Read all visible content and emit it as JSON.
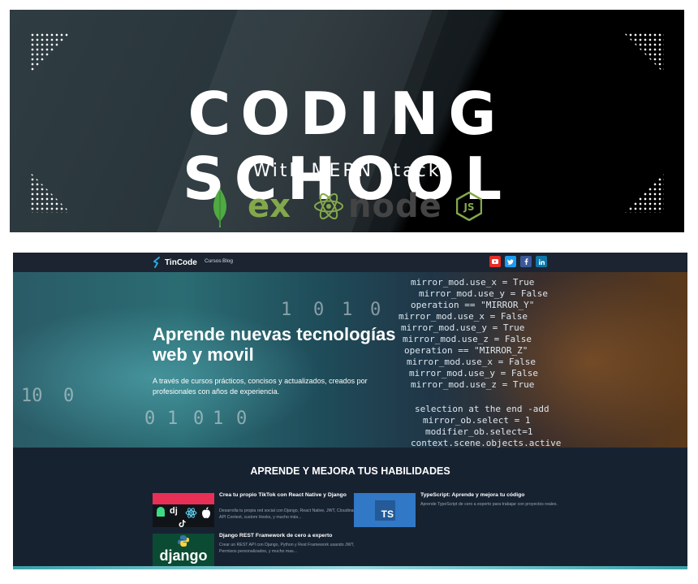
{
  "banner": {
    "title": "CODING SCHOOL",
    "subtitle": "With MERN stack",
    "logo_ex": "ex",
    "logo_node": "node",
    "logo_js": "JS",
    "icons": [
      "mongodb-leaf-icon",
      "express-icon",
      "react-icon",
      "nodejs-icon"
    ]
  },
  "navbar": {
    "brand": "TinCode",
    "links": [
      "Cursos",
      "Blog"
    ],
    "social": [
      {
        "icon": "youtube-icon",
        "color": "#e52d27"
      },
      {
        "icon": "twitter-icon",
        "color": "#1d9bf0"
      },
      {
        "icon": "facebook-icon",
        "color": "#3b5998"
      },
      {
        "icon": "linkedin-icon",
        "color": "#0e76a8"
      }
    ]
  },
  "hero": {
    "title": "Aprende nuevas tecnologías web y movil",
    "description": "A través de cursos prácticos, concisos y actualizados, creados por profesionales con años de experiencia.",
    "code_lines": [
      "mirror_mod.use_x = True",
      "mirror_mod.use_y = False",
      "operation == \"MIRROR_Y\"",
      "mirror_mod.use_x = False",
      "mirror_mod.use_y = True",
      "mirror_mod.use_z = False",
      "operation == \"MIRROR_Z\"",
      "mirror_mod.use_x = False",
      "mirror_mod.use_y = False",
      "mirror_mod.use_z = True",
      "selection at the end -add",
      "mirror_ob.select = 1",
      "modifier_ob.select=1",
      "context.scene.objects.active"
    ],
    "digits": [
      "1",
      "0",
      "1",
      "0",
      "0",
      "1",
      "0",
      "1",
      "0",
      "10",
      "0"
    ]
  },
  "skills": {
    "heading": "APRENDE Y MEJORA TUS HABILIDADES"
  },
  "courses": [
    {
      "title": "Crea tu propio TikTok con React Native y Django",
      "description": "Desarrolla tu propia red social con Django, React Native, JWT, Cloudinary, API Context, custom Hooks, y mucho más...",
      "thumb_text": "dj"
    },
    {
      "title": "TypeScript: Aprende y mejora tu código",
      "description": "Aprende TypeScript de cero a experto para trabajar con proyectos reales.",
      "thumb_text": "TS"
    },
    {
      "title": "Django REST Framework de cero a experto",
      "description": "Crear un REST API con Django, Python y Rest Framework usando JWT, Permisos personalizados, y mucho mas...",
      "thumb_text": "django"
    }
  ]
}
